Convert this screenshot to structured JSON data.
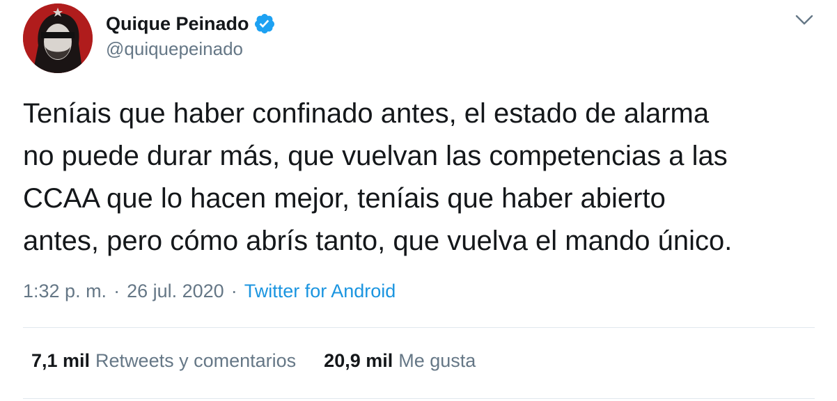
{
  "tweet": {
    "author": {
      "display_name": "Quique Peinado",
      "handle": "@quiquepeinado",
      "verified": true,
      "avatar_icon": "avatar-portrait"
    },
    "menu_icon": "chevron-down-icon",
    "text": "Teníais que haber confinado antes, el estado de alarma\nno puede durar más, que vuelvan las competencias a las\nCCAA que lo hacen mejor, teníais que haber abierto\nantes, pero cómo abrís tanto, que vuelva el mando único.",
    "time": "1:32 p. m.",
    "separator": "·",
    "date": "26 jul. 2020",
    "source": "Twitter for Android",
    "stats": {
      "retweets_count": "7,1 mil",
      "retweets_label": "Retweets y comentarios",
      "likes_count": "20,9 mil",
      "likes_label": "Me gusta"
    },
    "colors": {
      "text": "#14171a",
      "secondary": "#657786",
      "link": "#1b95e0",
      "verified": "#1da1f2",
      "divider": "#e1e8ed",
      "avatar_bg": "#b01c1c"
    }
  }
}
